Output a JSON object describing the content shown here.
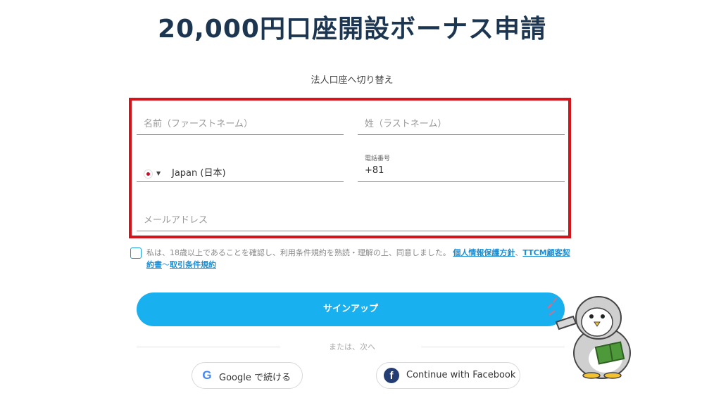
{
  "page": {
    "title": "20,000円口座開設ボーナス申請",
    "switch_link": "法人口座へ切り替え"
  },
  "form": {
    "first_name": {
      "placeholder": "名前（ファーストネーム）"
    },
    "last_name": {
      "placeholder": "姓（ラストネーム）"
    },
    "country": {
      "value": "Japan (日本)",
      "flag_icon": "japan-flag-icon"
    },
    "phone": {
      "label": "電話番号",
      "value": "+81"
    },
    "email": {
      "placeholder": "メールアドレス"
    }
  },
  "terms": {
    "text": "私は、18歳以上であることを確認し、利用条件規約を熟読・理解の上、同意しました。",
    "link1": "個人情報保護方針",
    "sep": "、",
    "link2": "TTCM顧客契約書",
    "sep2": "～",
    "link3": "取引条件規約"
  },
  "signup": {
    "label": "サインアップ"
  },
  "divider": {
    "text": "または、次へ"
  },
  "social": {
    "google": {
      "label": "Google で続ける",
      "icon": "google-icon"
    },
    "facebook": {
      "label": "Continue with Facebook",
      "icon": "facebook-icon"
    }
  },
  "colors": {
    "accent": "#18b0ee",
    "highlight": "#d4141b",
    "title": "#1c3550"
  }
}
